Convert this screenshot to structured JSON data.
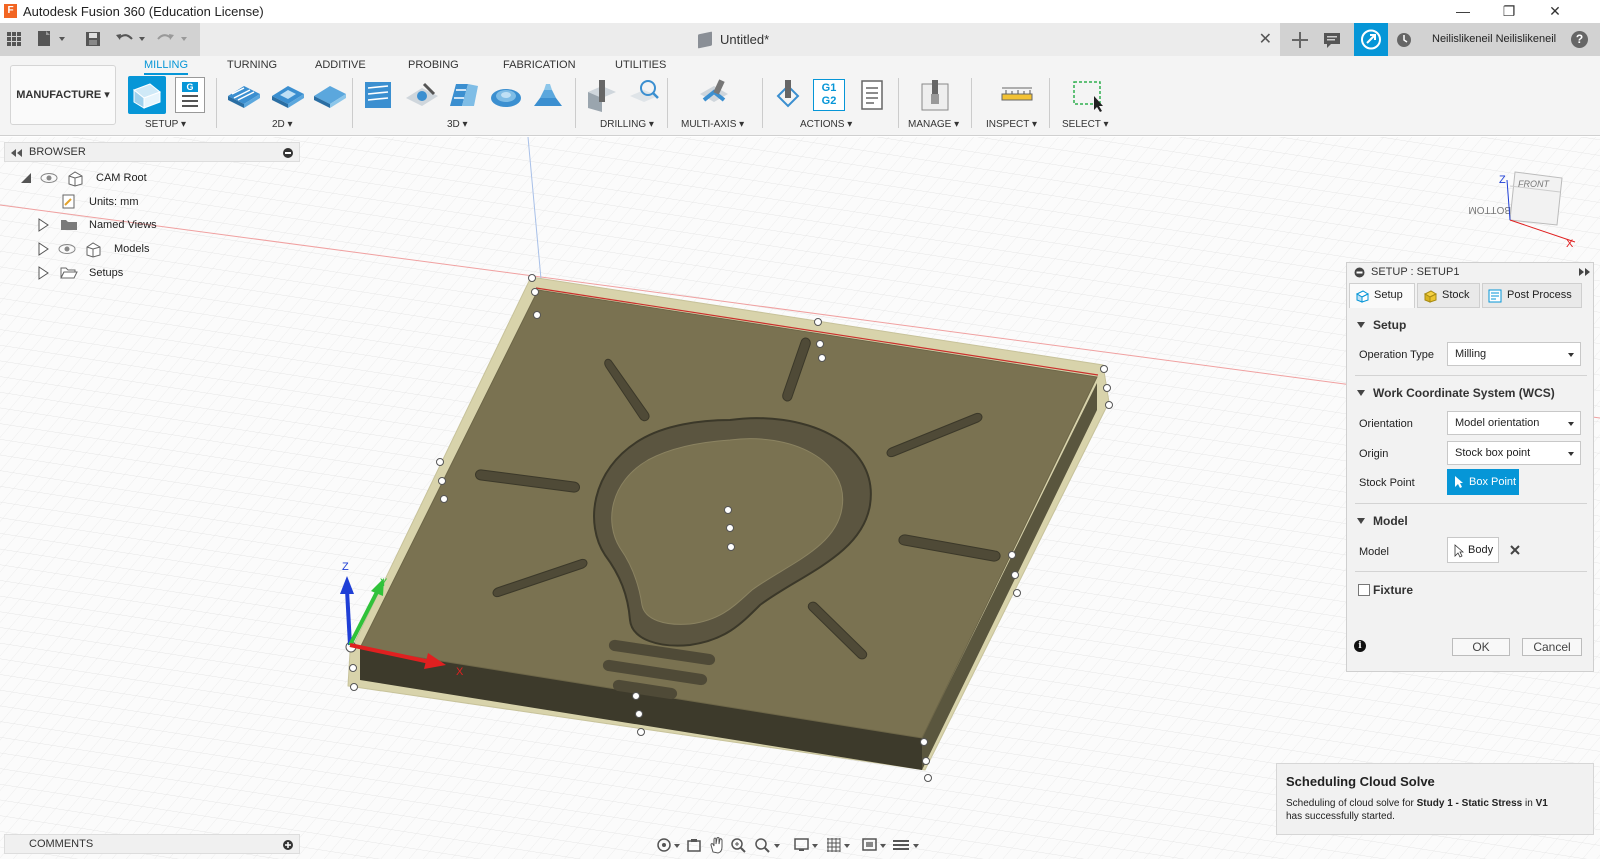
{
  "window": {
    "title": "Autodesk Fusion 360 (Education License)",
    "app_icon": "F",
    "minimize": "—",
    "maximize": "❐",
    "close": "✕"
  },
  "document": {
    "tab_title": "Untitled*",
    "close_glyph": "✕"
  },
  "quick_access": {
    "user_name": "Neilislikeneil Neilislikeneil",
    "help_glyph": "?"
  },
  "ribbon": {
    "workspace": "MANUFACTURE ▾",
    "tabs": [
      "MILLING",
      "TURNING",
      "ADDITIVE",
      "PROBING",
      "FABRICATION",
      "UTILITIES"
    ],
    "groups": [
      "SETUP ▾",
      "2D ▾",
      "3D ▾",
      "DRILLING ▾",
      "MULTI-AXIS ▾",
      "ACTIONS ▾",
      "MANAGE ▾",
      "INSPECT ▾",
      "SELECT ▾"
    ],
    "actions_badge_top": "G1",
    "actions_badge_bottom": "G2",
    "setup_badge": "G"
  },
  "browser": {
    "title": "BROWSER",
    "items": [
      {
        "label": "CAM Root"
      },
      {
        "label": "Units: mm"
      },
      {
        "label": "Named Views"
      },
      {
        "label": "Models"
      },
      {
        "label": "Setups"
      }
    ]
  },
  "viewcube": {
    "front": "FRONT",
    "bottom": "BOTTOM",
    "z": "Z",
    "x": "X"
  },
  "triad": {
    "z": "Z",
    "y": "Y",
    "x": "X"
  },
  "dialog": {
    "title": "SETUP : SETUP1",
    "tabs": [
      "Setup",
      "Stock",
      "Post Process"
    ],
    "section_setup": "Setup",
    "operation_type_label": "Operation Type",
    "operation_type_value": "Milling",
    "section_wcs": "Work Coordinate System (WCS)",
    "orientation_label": "Orientation",
    "orientation_value": "Model orientation",
    "origin_label": "Origin",
    "origin_value": "Stock box point",
    "stock_point_label": "Stock Point",
    "stock_point_value": "Box Point",
    "section_model": "Model",
    "model_label": "Model",
    "model_value": "Body",
    "fixture_label": "Fixture",
    "ok": "OK",
    "cancel": "Cancel",
    "info_glyph": "i"
  },
  "toast": {
    "title": "Scheduling Cloud Solve",
    "body_prefix": "Scheduling of cloud solve for ",
    "body_study": "Study 1 - Static Stress",
    "body_mid": " in ",
    "body_version": "V1",
    "body_suffix": "has successfully started."
  },
  "comments": {
    "title": "COMMENTS"
  },
  "colors": {
    "accent": "#0696d7",
    "part_top": "#7a7251",
    "part_side": "#3f3b2c",
    "stock_outline": "#d8d3ab"
  }
}
